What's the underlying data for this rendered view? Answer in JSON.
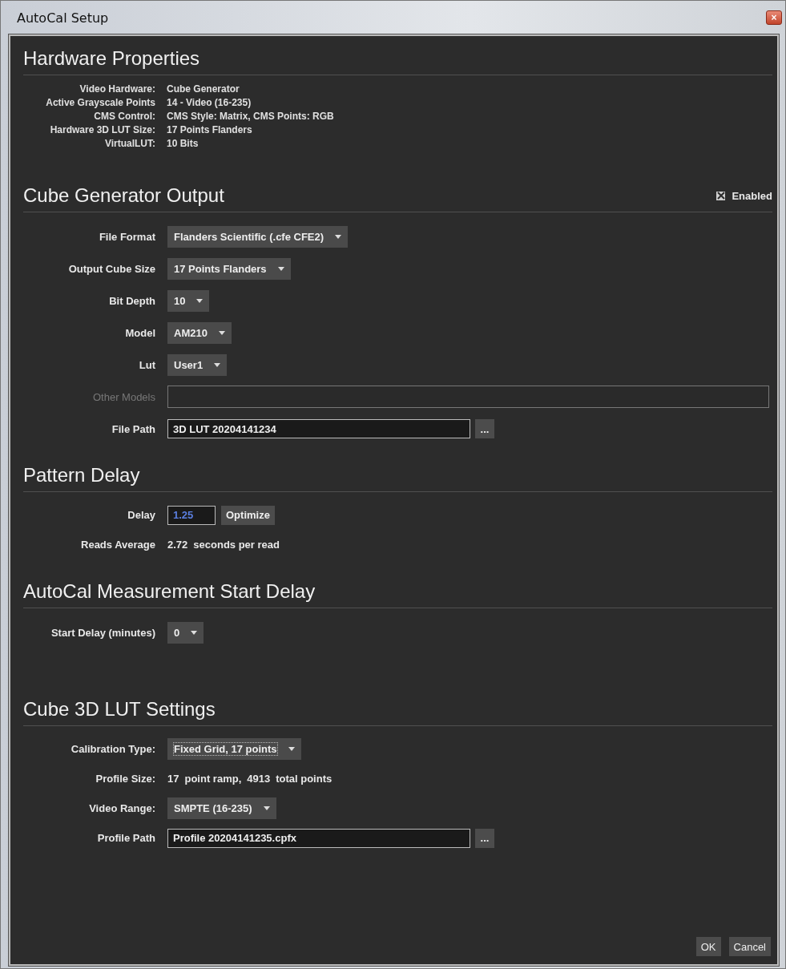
{
  "window": {
    "title": "AutoCal Setup",
    "close": "×"
  },
  "hardware": {
    "title": "Hardware Properties",
    "props": [
      {
        "label": "Video Hardware:",
        "value": "Cube Generator"
      },
      {
        "label": "Active Grayscale Points",
        "value": "14 - Video (16-235)"
      },
      {
        "label": "CMS Control:",
        "value": "CMS Style: Matrix, CMS Points: RGB"
      },
      {
        "label": "Hardware 3D LUT Size:",
        "value": "17 Points Flanders"
      },
      {
        "label": "VirtualLUT:",
        "value": "10 Bits"
      }
    ]
  },
  "cube_output": {
    "title": "Cube Generator Output",
    "enabled": {
      "label": "Enabled",
      "checked": true
    },
    "rows": [
      {
        "kind": "select",
        "label": "File Format",
        "value": "Flanders Scientific (.cfe CFE2)"
      },
      {
        "kind": "select",
        "label": "Output Cube Size",
        "value": "17 Points Flanders"
      },
      {
        "kind": "select",
        "label": "Bit Depth",
        "value": "10"
      },
      {
        "kind": "select",
        "label": "Model",
        "value": "AM210"
      },
      {
        "kind": "select",
        "label": "Lut",
        "value": "User1"
      },
      {
        "kind": "text",
        "label": "Other Models",
        "disabled": true
      },
      {
        "kind": "path",
        "label": "File Path",
        "value": "3D LUT 20204141234",
        "button": "..."
      }
    ]
  },
  "pattern_delay": {
    "title": "Pattern Delay",
    "rows": [
      {
        "kind": "delay",
        "label": "Delay",
        "value": "1.25",
        "button": "Optimize"
      },
      {
        "kind": "info",
        "label": "Reads Average",
        "parts": [
          "2.72",
          "seconds per read"
        ]
      }
    ]
  },
  "start_delay": {
    "title": "AutoCal Measurement Start Delay",
    "rows": [
      {
        "kind": "select",
        "label": "Start Delay (minutes)",
        "value": "0"
      }
    ]
  },
  "lut_settings": {
    "title": "Cube 3D LUT Settings",
    "rows": [
      {
        "kind": "select",
        "label": "Calibration Type:",
        "value": "Fixed Grid, 17 points",
        "focused": true
      },
      {
        "kind": "info",
        "label": "Profile Size:",
        "parts": [
          "17",
          "point ramp,",
          "4913",
          "total points"
        ]
      },
      {
        "kind": "select",
        "label": "Video Range:",
        "value": "SMPTE (16-235)"
      },
      {
        "kind": "path",
        "label": "Profile Path",
        "value": "Profile 20204141235.cpfx",
        "button": "..."
      }
    ]
  },
  "buttons": [
    "OK",
    "Cancel"
  ]
}
